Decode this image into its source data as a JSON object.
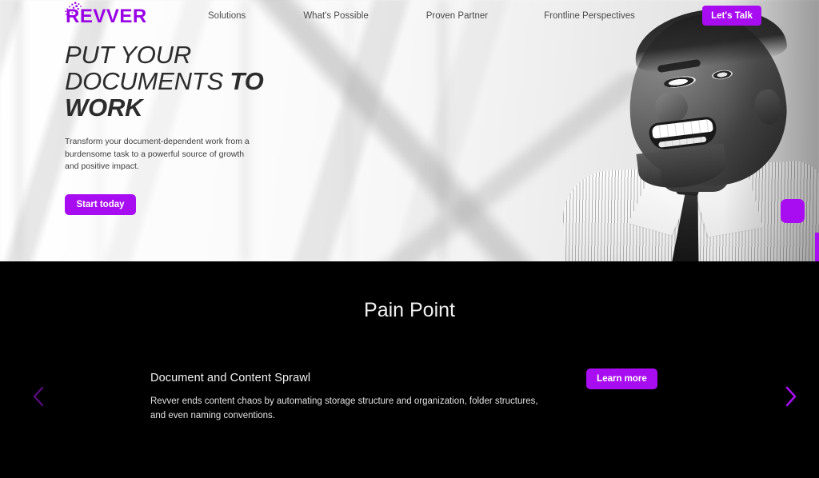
{
  "brand": {
    "logo_text": "REVVER",
    "accent_color": "#a80df2",
    "logo_color": "#9900e6"
  },
  "nav": {
    "links": [
      {
        "label": "Solutions"
      },
      {
        "label": "What's Possible"
      },
      {
        "label": "Proven Partner"
      },
      {
        "label": "Frontline Perspectives"
      }
    ],
    "cta_label": "Let's Talk"
  },
  "hero": {
    "title_line1": "PUT YOUR",
    "title_line2_normal": "DOCUMENTS ",
    "title_line2_bold": "TO",
    "title_line3_bold": "WORK",
    "subtitle": "Transform your document-dependent work from a burdensome task to a powerful source of growth and positive impact.",
    "button_label": "Start today"
  },
  "pain_point": {
    "section_title": "Pain Point",
    "slide": {
      "heading": "Document and Content Sprawl",
      "body": "Revver ends content chaos by automating storage structure and organization, folder structures, and even naming conventions.",
      "button_label": "Learn more"
    },
    "prev_label": "Previous slide",
    "next_label": "Next slide"
  }
}
